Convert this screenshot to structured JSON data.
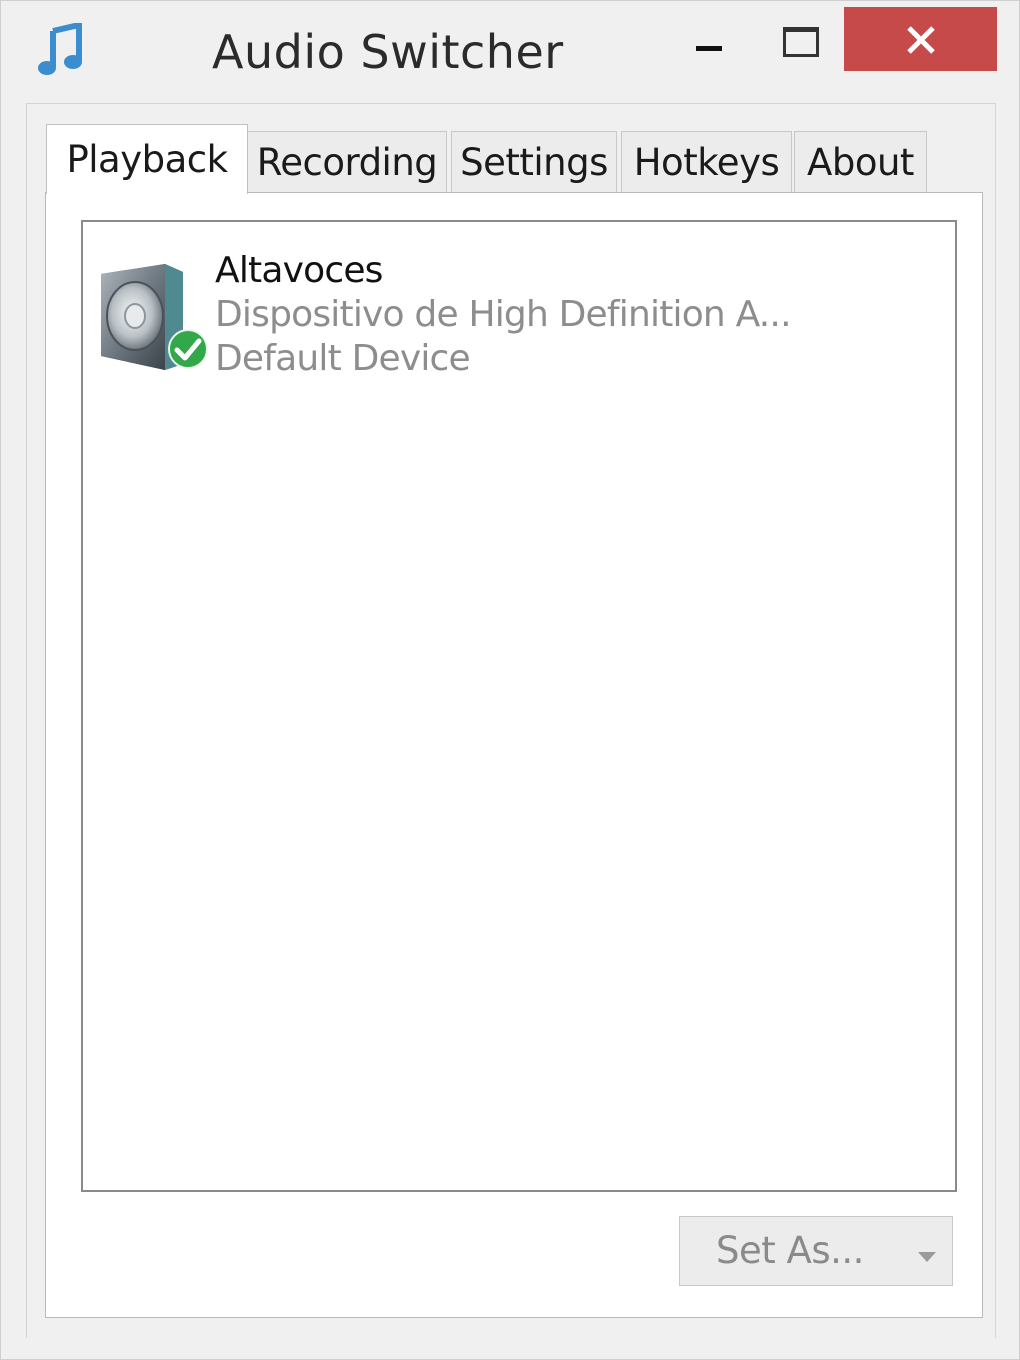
{
  "window": {
    "title": "Audio Switcher",
    "app_icon": "music-note-icon",
    "controls": {
      "minimize": "minimize-icon",
      "maximize": "maximize-icon",
      "close": "close-icon"
    },
    "colors": {
      "close_button": "#c74a4a",
      "app_icon": "#3a8ed0"
    }
  },
  "tabs": [
    {
      "label": "Playback",
      "active": true
    },
    {
      "label": "Recording",
      "active": false
    },
    {
      "label": "Settings",
      "active": false
    },
    {
      "label": "Hotkeys",
      "active": false
    },
    {
      "label": "About",
      "active": false
    }
  ],
  "devices": [
    {
      "name": "Altavoces",
      "description": "Dispositivo de High Definition A...",
      "status": "Default Device",
      "icon": "speaker-icon",
      "badge": "default-checkmark-icon"
    }
  ],
  "actions": {
    "set_as_label": "Set As...",
    "set_as_arrow": "dropdown-arrow-icon"
  }
}
